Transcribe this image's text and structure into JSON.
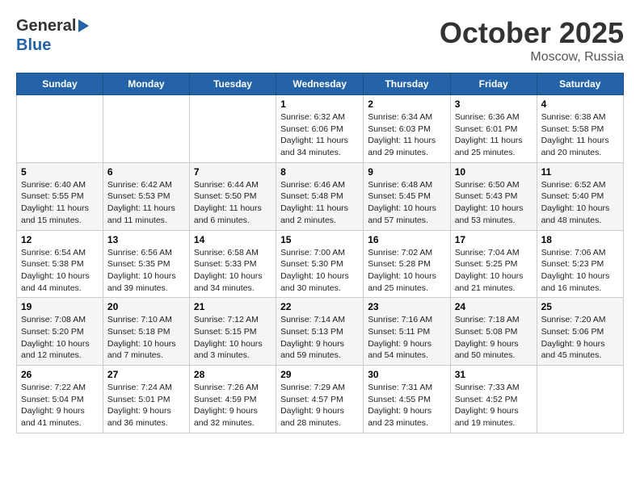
{
  "logo": {
    "line1": "General",
    "line2": "Blue"
  },
  "title": "October 2025",
  "subtitle": "Moscow, Russia",
  "days_of_week": [
    "Sunday",
    "Monday",
    "Tuesday",
    "Wednesday",
    "Thursday",
    "Friday",
    "Saturday"
  ],
  "weeks": [
    [
      {
        "day": "",
        "info": ""
      },
      {
        "day": "",
        "info": ""
      },
      {
        "day": "",
        "info": ""
      },
      {
        "day": "1",
        "info": "Sunrise: 6:32 AM\nSunset: 6:06 PM\nDaylight: 11 hours and 34 minutes."
      },
      {
        "day": "2",
        "info": "Sunrise: 6:34 AM\nSunset: 6:03 PM\nDaylight: 11 hours and 29 minutes."
      },
      {
        "day": "3",
        "info": "Sunrise: 6:36 AM\nSunset: 6:01 PM\nDaylight: 11 hours and 25 minutes."
      },
      {
        "day": "4",
        "info": "Sunrise: 6:38 AM\nSunset: 5:58 PM\nDaylight: 11 hours and 20 minutes."
      }
    ],
    [
      {
        "day": "5",
        "info": "Sunrise: 6:40 AM\nSunset: 5:55 PM\nDaylight: 11 hours and 15 minutes."
      },
      {
        "day": "6",
        "info": "Sunrise: 6:42 AM\nSunset: 5:53 PM\nDaylight: 11 hours and 11 minutes."
      },
      {
        "day": "7",
        "info": "Sunrise: 6:44 AM\nSunset: 5:50 PM\nDaylight: 11 hours and 6 minutes."
      },
      {
        "day": "8",
        "info": "Sunrise: 6:46 AM\nSunset: 5:48 PM\nDaylight: 11 hours and 2 minutes."
      },
      {
        "day": "9",
        "info": "Sunrise: 6:48 AM\nSunset: 5:45 PM\nDaylight: 10 hours and 57 minutes."
      },
      {
        "day": "10",
        "info": "Sunrise: 6:50 AM\nSunset: 5:43 PM\nDaylight: 10 hours and 53 minutes."
      },
      {
        "day": "11",
        "info": "Sunrise: 6:52 AM\nSunset: 5:40 PM\nDaylight: 10 hours and 48 minutes."
      }
    ],
    [
      {
        "day": "12",
        "info": "Sunrise: 6:54 AM\nSunset: 5:38 PM\nDaylight: 10 hours and 44 minutes."
      },
      {
        "day": "13",
        "info": "Sunrise: 6:56 AM\nSunset: 5:35 PM\nDaylight: 10 hours and 39 minutes."
      },
      {
        "day": "14",
        "info": "Sunrise: 6:58 AM\nSunset: 5:33 PM\nDaylight: 10 hours and 34 minutes."
      },
      {
        "day": "15",
        "info": "Sunrise: 7:00 AM\nSunset: 5:30 PM\nDaylight: 10 hours and 30 minutes."
      },
      {
        "day": "16",
        "info": "Sunrise: 7:02 AM\nSunset: 5:28 PM\nDaylight: 10 hours and 25 minutes."
      },
      {
        "day": "17",
        "info": "Sunrise: 7:04 AM\nSunset: 5:25 PM\nDaylight: 10 hours and 21 minutes."
      },
      {
        "day": "18",
        "info": "Sunrise: 7:06 AM\nSunset: 5:23 PM\nDaylight: 10 hours and 16 minutes."
      }
    ],
    [
      {
        "day": "19",
        "info": "Sunrise: 7:08 AM\nSunset: 5:20 PM\nDaylight: 10 hours and 12 minutes."
      },
      {
        "day": "20",
        "info": "Sunrise: 7:10 AM\nSunset: 5:18 PM\nDaylight: 10 hours and 7 minutes."
      },
      {
        "day": "21",
        "info": "Sunrise: 7:12 AM\nSunset: 5:15 PM\nDaylight: 10 hours and 3 minutes."
      },
      {
        "day": "22",
        "info": "Sunrise: 7:14 AM\nSunset: 5:13 PM\nDaylight: 9 hours and 59 minutes."
      },
      {
        "day": "23",
        "info": "Sunrise: 7:16 AM\nSunset: 5:11 PM\nDaylight: 9 hours and 54 minutes."
      },
      {
        "day": "24",
        "info": "Sunrise: 7:18 AM\nSunset: 5:08 PM\nDaylight: 9 hours and 50 minutes."
      },
      {
        "day": "25",
        "info": "Sunrise: 7:20 AM\nSunset: 5:06 PM\nDaylight: 9 hours and 45 minutes."
      }
    ],
    [
      {
        "day": "26",
        "info": "Sunrise: 7:22 AM\nSunset: 5:04 PM\nDaylight: 9 hours and 41 minutes."
      },
      {
        "day": "27",
        "info": "Sunrise: 7:24 AM\nSunset: 5:01 PM\nDaylight: 9 hours and 36 minutes."
      },
      {
        "day": "28",
        "info": "Sunrise: 7:26 AM\nSunset: 4:59 PM\nDaylight: 9 hours and 32 minutes."
      },
      {
        "day": "29",
        "info": "Sunrise: 7:29 AM\nSunset: 4:57 PM\nDaylight: 9 hours and 28 minutes."
      },
      {
        "day": "30",
        "info": "Sunrise: 7:31 AM\nSunset: 4:55 PM\nDaylight: 9 hours and 23 minutes."
      },
      {
        "day": "31",
        "info": "Sunrise: 7:33 AM\nSunset: 4:52 PM\nDaylight: 9 hours and 19 minutes."
      },
      {
        "day": "",
        "info": ""
      }
    ]
  ]
}
